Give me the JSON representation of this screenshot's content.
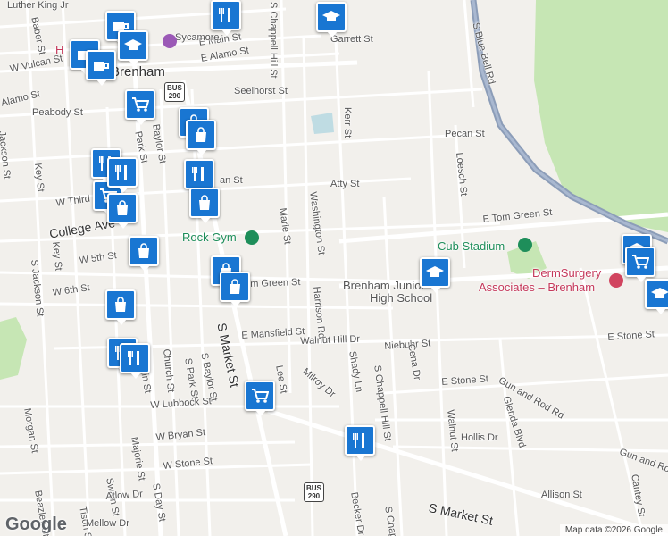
{
  "map": {
    "colors": {
      "background": "#f2f0ec",
      "road": "#ffffff",
      "road_edge": "#d6d3cc",
      "highway": "#8c9db8",
      "park": "#c6e6b4",
      "water": "#aad3df",
      "pin": "#1976d2"
    },
    "streets": [
      {
        "text": "Luther King Jr"
      },
      {
        "text": "Baber St"
      },
      {
        "text": "E Main St"
      },
      {
        "text": "E Alamo St"
      },
      {
        "text": "Sycamore"
      },
      {
        "text": "Garrett St"
      },
      {
        "text": "W Vulcan St"
      },
      {
        "text": "Alamo St"
      },
      {
        "text": "Peabody St"
      },
      {
        "text": "Seelhorst St"
      },
      {
        "text": "S Chappell Hill St"
      },
      {
        "text": "S Blue Bell Rd"
      },
      {
        "text": "Kerr St"
      },
      {
        "text": "Pecan St"
      },
      {
        "text": "Loesch St"
      },
      {
        "text": "Jackson St"
      },
      {
        "text": "Park St"
      },
      {
        "text": "Baylor St"
      },
      {
        "text": "Key St"
      },
      {
        "text": "W Third St"
      },
      {
        "text": "College Ave"
      },
      {
        "text": "Key St"
      },
      {
        "text": "W 5th St"
      },
      {
        "text": "W 6th St"
      },
      {
        "text": "S Jackson St"
      },
      {
        "text": "Washington St"
      },
      {
        "text": "Marie St"
      },
      {
        "text": "Atty St"
      },
      {
        "text": "an St"
      },
      {
        "text": "E Tom Green St"
      },
      {
        "text": "m Green St"
      },
      {
        "text": "Harrison Rd"
      },
      {
        "text": "E Mansfield St"
      },
      {
        "text": "Walnut Hill Dr"
      },
      {
        "text": "Niebuhr St"
      },
      {
        "text": "E Stone St"
      },
      {
        "text": "E Stone St"
      },
      {
        "text": "S Market St"
      },
      {
        "text": "S Baylor St"
      },
      {
        "text": "S Park St"
      },
      {
        "text": "Church St"
      },
      {
        "text": "S Austin St"
      },
      {
        "text": "Lee St"
      },
      {
        "text": "Milroy Dr"
      },
      {
        "text": "Shady Ln"
      },
      {
        "text": "S Chappell Hill St"
      },
      {
        "text": "Cena Dr"
      },
      {
        "text": "Gun and Rod Rd"
      },
      {
        "text": "Glenda Blvd"
      },
      {
        "text": "Gun and Rod"
      },
      {
        "text": "Walnut St"
      },
      {
        "text": "W Lubbock St"
      },
      {
        "text": "W Bryan St"
      },
      {
        "text": "W Stone St"
      },
      {
        "text": "Morgan St"
      },
      {
        "text": "Majorie St"
      },
      {
        "text": "S Day St"
      },
      {
        "text": "Hollis Dr"
      },
      {
        "text": "Swain St"
      },
      {
        "text": "Atlow Dr"
      },
      {
        "text": "Beazley St"
      },
      {
        "text": "Tison St"
      },
      {
        "text": "Becker Dr"
      },
      {
        "text": "S Chappell"
      },
      {
        "text": "S Market St"
      },
      {
        "text": "Allison St"
      },
      {
        "text": "Cantey St"
      },
      {
        "text": "Mellow Dr"
      }
    ],
    "places": [
      {
        "text": "Brenham"
      },
      {
        "text": "Rock Gym"
      },
      {
        "text": "Cub Stadium"
      },
      {
        "text": "DermSurgery"
      },
      {
        "text": "Associates – Brenham"
      },
      {
        "text": "Brenham Junior"
      },
      {
        "text": "High School"
      },
      {
        "text": "H"
      }
    ],
    "shields": [
      {
        "text": "BUS"
      },
      {
        "text": "290"
      },
      {
        "text": "BUS"
      },
      {
        "text": "290"
      }
    ],
    "pins": [
      {
        "icon": "coffee-icon"
      },
      {
        "icon": "coffee-icon"
      },
      {
        "icon": "coffee-icon"
      },
      {
        "icon": "restaurant-icon"
      },
      {
        "icon": "school-icon"
      },
      {
        "icon": "school-icon"
      },
      {
        "icon": "restaurant-icon"
      },
      {
        "icon": "shopping-cart-icon"
      },
      {
        "icon": "shopping-bag-icon"
      },
      {
        "icon": "shopping-bag-icon"
      },
      {
        "icon": "restaurant-icon"
      },
      {
        "icon": "shopping-cart-icon"
      },
      {
        "icon": "shopping-bag-icon"
      },
      {
        "icon": "restaurant-icon"
      },
      {
        "icon": "shopping-bag-icon"
      },
      {
        "icon": "shopping-bag-icon"
      },
      {
        "icon": "shopping-bag-icon"
      },
      {
        "icon": "shopping-bag-icon"
      },
      {
        "icon": "restaurant-icon"
      },
      {
        "icon": "restaurant-icon"
      },
      {
        "icon": "shopping-bag-icon"
      },
      {
        "icon": "shopping-cart-icon"
      },
      {
        "icon": "restaurant-icon"
      },
      {
        "icon": "school-icon"
      },
      {
        "icon": "school-icon"
      },
      {
        "icon": "shopping-cart-icon"
      },
      {
        "icon": "school-icon"
      }
    ],
    "logo": "Google",
    "attribution": "Map data ©2026 Google"
  }
}
